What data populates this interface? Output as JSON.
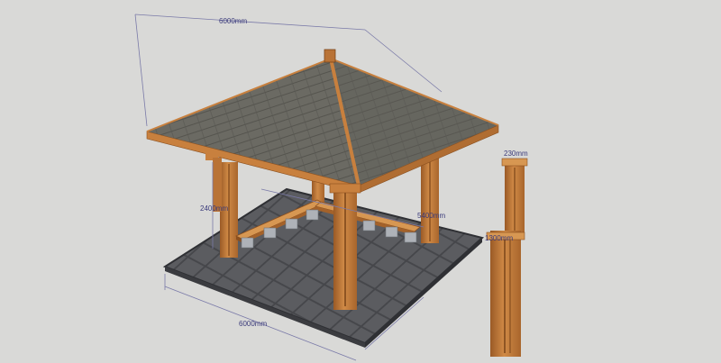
{
  "scene": {
    "background": "#d9d9d7",
    "colors": {
      "timber": "#c8803e",
      "timber_dark": "#8a4f1f",
      "timber_light": "#e0a060",
      "roof": "#6b6a63",
      "roof_dark": "#4e4d48",
      "floor": "#5a5b5f",
      "floor_edge": "#2f3034",
      "block": "#a9adb3",
      "dimension_line": "#6a6a9a"
    }
  },
  "dimensions": {
    "roof_width": "6000mm",
    "floor_width": "6000mm",
    "post_height": "2400mm",
    "inner_dim": "5400mm",
    "post_width": "230mm",
    "post_section": "1300mm"
  },
  "objects": {
    "main_model": "gazebo-model",
    "detail_model": "post-detail"
  }
}
